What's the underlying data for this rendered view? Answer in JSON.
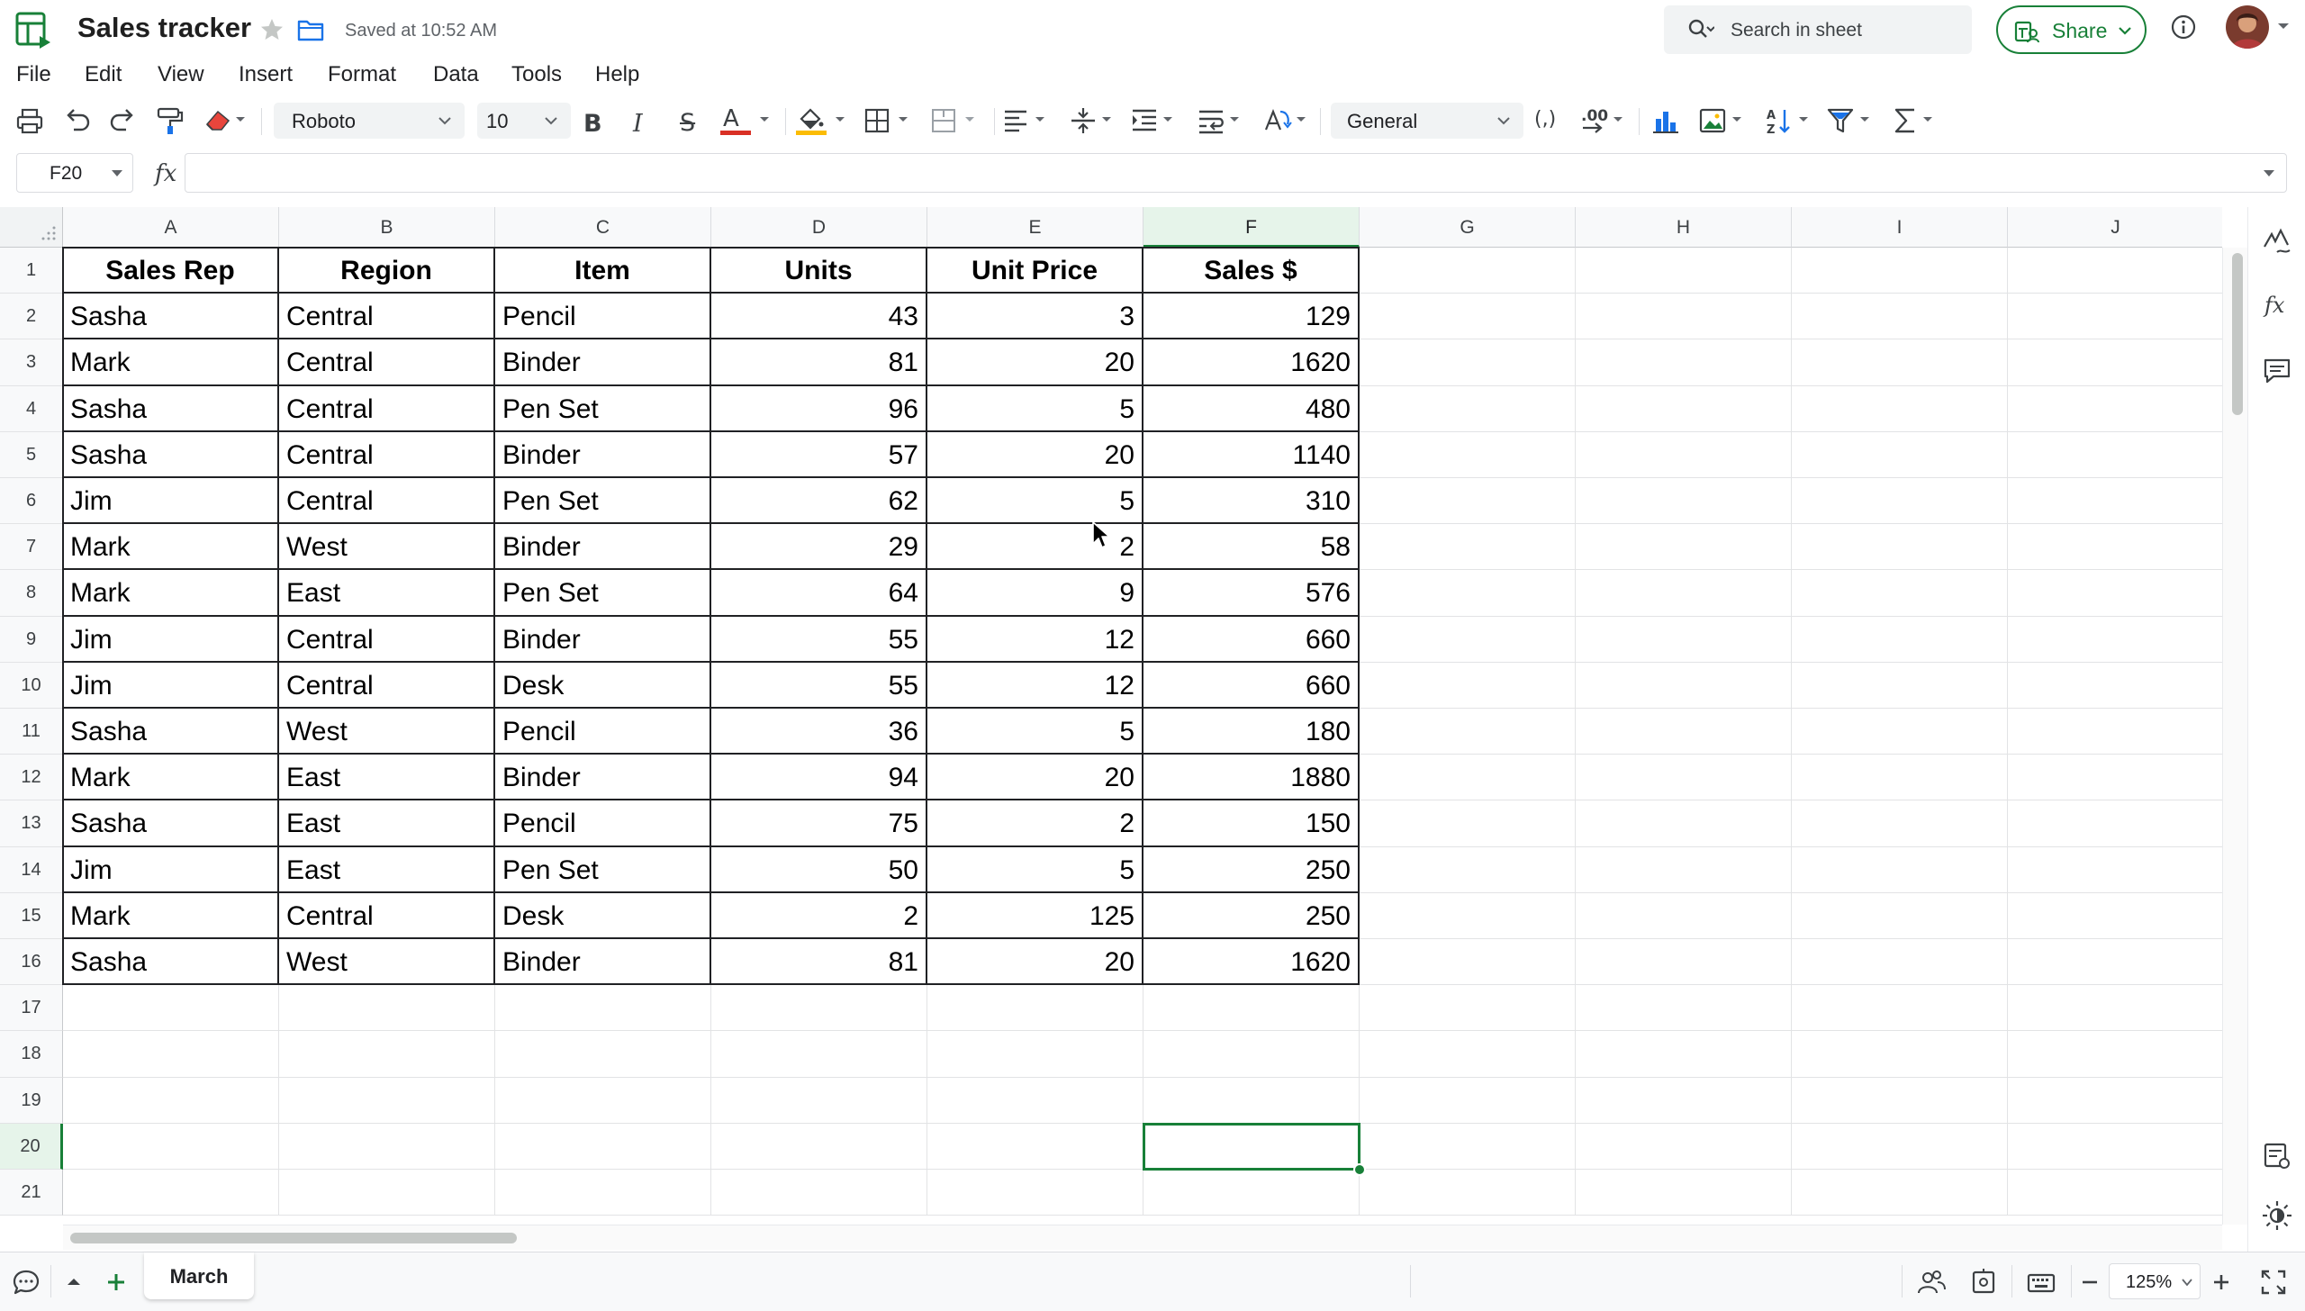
{
  "app": {
    "title": "Sales tracker",
    "saved_status": "Saved at 10:52 AM",
    "search_placeholder": "Search in sheet",
    "share_label": "Share",
    "accent_color": "#188038"
  },
  "menu": [
    "File",
    "Edit",
    "View",
    "Insert",
    "Format",
    "Data",
    "Tools",
    "Help"
  ],
  "toolbar": {
    "font_family": "Roboto",
    "font_size": "10",
    "number_format": "General",
    "bold_label": "B",
    "italic_label": "I",
    "strike_label": "S",
    "text_color_label": "A",
    "text_color": "#d93025",
    "fill_color": "#fbbc04",
    "comma_style_label": "(,)",
    "decimal_label": ".00"
  },
  "formula_bar": {
    "cell_ref": "F20",
    "fx_label": "fx",
    "formula": ""
  },
  "grid": {
    "columns": [
      "A",
      "B",
      "C",
      "D",
      "E",
      "F",
      "G",
      "H",
      "I",
      "J"
    ],
    "rows": [
      "1",
      "2",
      "3",
      "4",
      "5",
      "6",
      "7",
      "8",
      "9",
      "10",
      "11",
      "12",
      "13",
      "14",
      "15",
      "16",
      "17",
      "18",
      "19",
      "20",
      "21"
    ],
    "active_column": "F",
    "active_row": "20",
    "selected_cell": "F20"
  },
  "table": {
    "headers": [
      "Sales Rep",
      "Region",
      "Item",
      "Units",
      "Unit Price",
      "Sales $"
    ],
    "rows": [
      [
        "Sasha",
        "Central",
        "Pencil",
        "43",
        "3",
        "129"
      ],
      [
        "Mark",
        "Central",
        "Binder",
        "81",
        "20",
        "1620"
      ],
      [
        "Sasha",
        "Central",
        "Pen Set",
        "96",
        "5",
        "480"
      ],
      [
        "Sasha",
        "Central",
        "Binder",
        "57",
        "20",
        "1140"
      ],
      [
        "Jim",
        "Central",
        "Pen Set",
        "62",
        "5",
        "310"
      ],
      [
        "Mark",
        "West",
        "Binder",
        "29",
        "2",
        "58"
      ],
      [
        "Mark",
        "East",
        "Pen Set",
        "64",
        "9",
        "576"
      ],
      [
        "Jim",
        "Central",
        "Binder",
        "55",
        "12",
        "660"
      ],
      [
        "Jim",
        "Central",
        "Desk",
        "55",
        "12",
        "660"
      ],
      [
        "Sasha",
        "West",
        "Pencil",
        "36",
        "5",
        "180"
      ],
      [
        "Mark",
        "East",
        "Binder",
        "94",
        "20",
        "1880"
      ],
      [
        "Sasha",
        "East",
        "Pencil",
        "75",
        "2",
        "150"
      ],
      [
        "Jim",
        "East",
        "Pen Set",
        "50",
        "5",
        "250"
      ],
      [
        "Mark",
        "Central",
        "Desk",
        "2",
        "125",
        "250"
      ],
      [
        "Sasha",
        "West",
        "Binder",
        "81",
        "20",
        "1620"
      ]
    ]
  },
  "sheets": {
    "tabs": [
      "March"
    ],
    "active": "March"
  },
  "zoom": "125%"
}
